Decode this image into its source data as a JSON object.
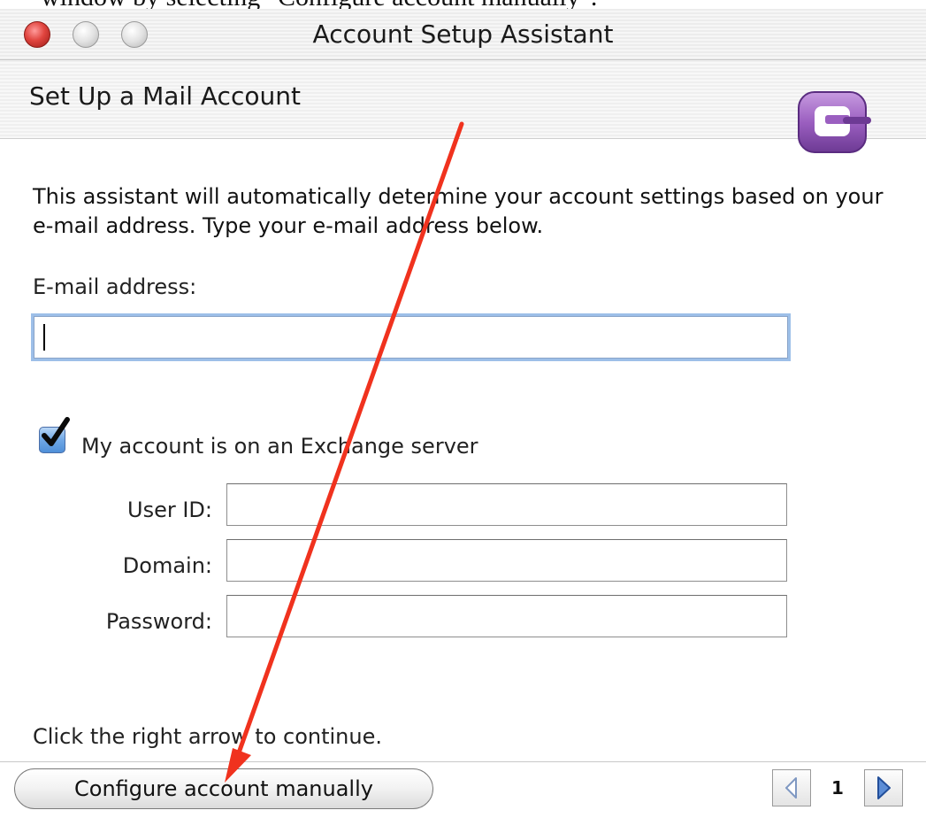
{
  "caption": {
    "text": "window by selecting \"Configure account manually\"."
  },
  "window": {
    "title": "Account Setup Assistant"
  },
  "header": {
    "title": "Set Up a Mail Account",
    "icon": "entourage-icon"
  },
  "intro": {
    "text": "This assistant will automatically determine your account settings based on your e-mail address. Type your e-mail address below."
  },
  "email": {
    "label": "E-mail address:",
    "value": ""
  },
  "exchange": {
    "checked": true,
    "label": "My account is on an Exchange server",
    "user_label": "User ID:",
    "user_value": "",
    "domain_label": "Domain:",
    "domain_value": "",
    "password_label": "Password:",
    "password_value": ""
  },
  "footer": {
    "continue_text": "Click the right arrow to continue.",
    "configure_button": "Configure account manually",
    "page_number": "1"
  },
  "annotation": {
    "color": "#f0321e"
  },
  "colors": {
    "focus_ring": "#9dbfe8",
    "checkbox_blue": "#4f8fd8",
    "close_red": "#e0443e",
    "entourage_purple": "#9b5fc0"
  }
}
